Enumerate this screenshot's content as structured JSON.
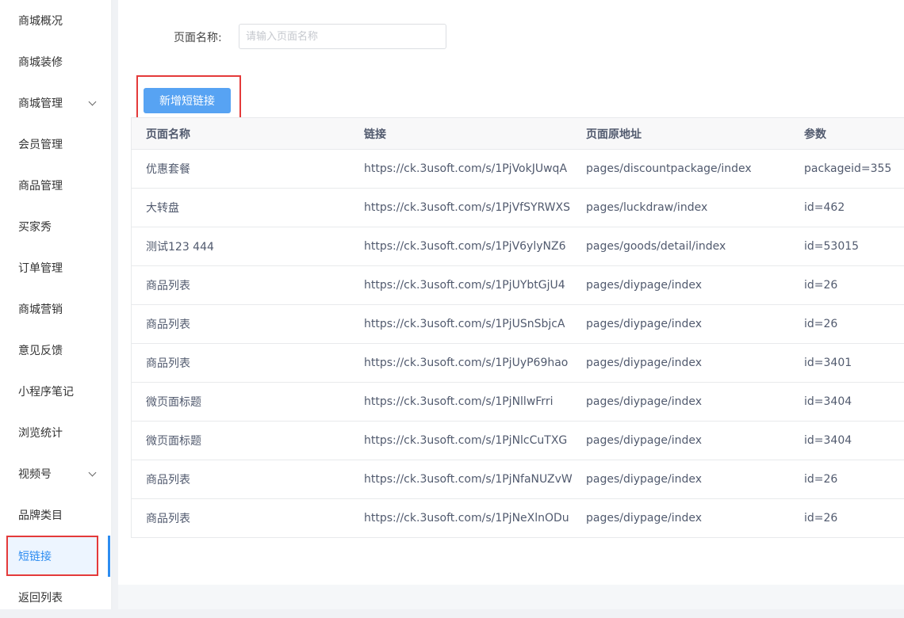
{
  "sidebar": {
    "items": [
      {
        "label": "商城概况",
        "has_chevron": false,
        "active": false
      },
      {
        "label": "商城装修",
        "has_chevron": false,
        "active": false
      },
      {
        "label": "商城管理",
        "has_chevron": true,
        "active": false
      },
      {
        "label": "会员管理",
        "has_chevron": false,
        "active": false
      },
      {
        "label": "商品管理",
        "has_chevron": false,
        "active": false
      },
      {
        "label": "买家秀",
        "has_chevron": false,
        "active": false
      },
      {
        "label": "订单管理",
        "has_chevron": false,
        "active": false
      },
      {
        "label": "商城营销",
        "has_chevron": false,
        "active": false
      },
      {
        "label": "意见反馈",
        "has_chevron": false,
        "active": false
      },
      {
        "label": "小程序笔记",
        "has_chevron": false,
        "active": false
      },
      {
        "label": "浏览统计",
        "has_chevron": false,
        "active": false
      },
      {
        "label": "视频号",
        "has_chevron": true,
        "active": false
      },
      {
        "label": "品牌类目",
        "has_chevron": false,
        "active": false
      },
      {
        "label": "短链接",
        "has_chevron": false,
        "active": true
      },
      {
        "label": "返回列表",
        "has_chevron": false,
        "active": false
      }
    ]
  },
  "filter": {
    "label": "页面名称:",
    "placeholder": "请输入页面名称",
    "value": ""
  },
  "toolbar": {
    "add_label": "新增短链接"
  },
  "table": {
    "columns": [
      "页面名称",
      "链接",
      "页面原地址",
      "参数"
    ],
    "rows": [
      [
        "优惠套餐",
        "https://ck.3usoft.com/s/1PjVokJUwqA",
        "pages/discountpackage/index",
        "packageid=355"
      ],
      [
        "大转盘",
        "https://ck.3usoft.com/s/1PjVfSYRWXS",
        "pages/luckdraw/index",
        "id=462"
      ],
      [
        "测试123 444",
        "https://ck.3usoft.com/s/1PjV6ylyNZ6",
        "pages/goods/detail/index",
        "id=53015"
      ],
      [
        "商品列表",
        "https://ck.3usoft.com/s/1PjUYbtGjU4",
        "pages/diypage/index",
        "id=26"
      ],
      [
        "商品列表",
        "https://ck.3usoft.com/s/1PjUSnSbjcA",
        "pages/diypage/index",
        "id=26"
      ],
      [
        "商品列表",
        "https://ck.3usoft.com/s/1PjUyP69hao",
        "pages/diypage/index",
        "id=3401"
      ],
      [
        "微页面标题",
        "https://ck.3usoft.com/s/1PjNllwFrri",
        "pages/diypage/index",
        "id=3404"
      ],
      [
        "微页面标题",
        "https://ck.3usoft.com/s/1PjNlcCuTXG",
        "pages/diypage/index",
        "id=3404"
      ],
      [
        "商品列表",
        "https://ck.3usoft.com/s/1PjNfaNUZvW",
        "pages/diypage/index",
        "id=26"
      ],
      [
        "商品列表",
        "https://ck.3usoft.com/s/1PjNeXlnODu",
        "pages/diypage/index",
        "id=26"
      ]
    ]
  },
  "colors": {
    "accent": "#2d8cf0",
    "button": "#57a3f3",
    "highlight": "#e43a3a"
  }
}
